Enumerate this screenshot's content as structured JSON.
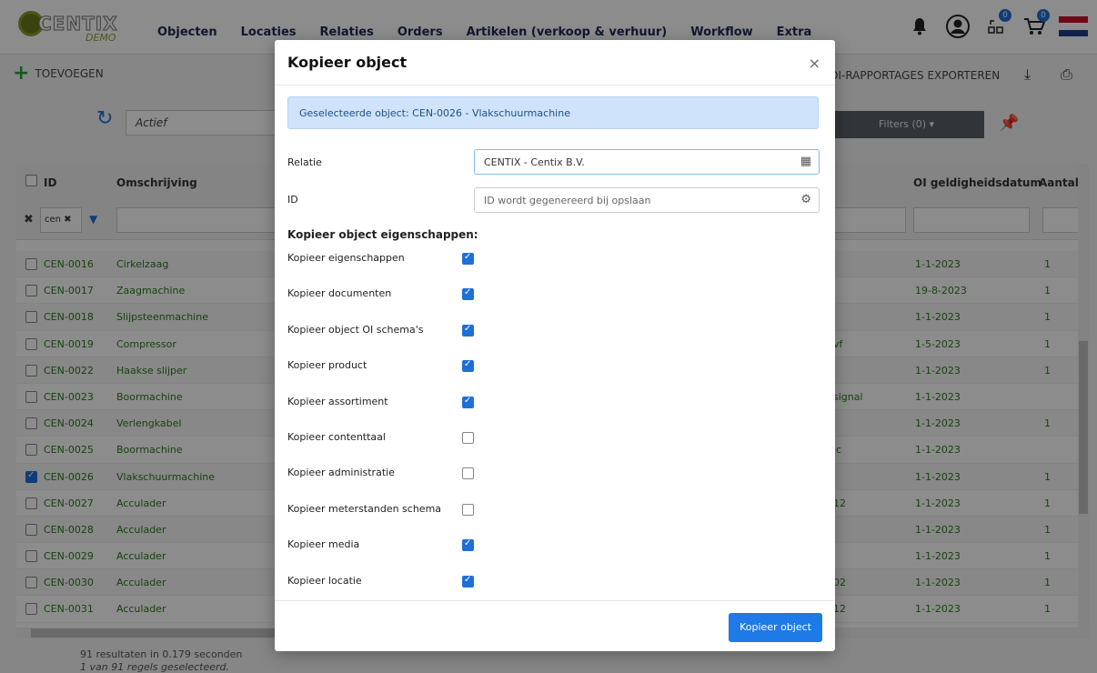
{
  "brand": {
    "name": "CENTIX",
    "tag": "DEMO"
  },
  "nav": {
    "items": [
      "Objecten",
      "Locaties",
      "Relaties",
      "Orders",
      "Artikelen (verkoop & verhuur)",
      "Workflow",
      "Extra"
    ],
    "badges": [
      "0",
      "0"
    ]
  },
  "toolbar": {
    "add_label": "TOEVOEGEN",
    "export_label": "OI-RAPPORTAGES EXPORTEREN"
  },
  "filters": {
    "status_value": "Actief",
    "filters_label": "Filters (0) ▾",
    "id_filter_value": "cen"
  },
  "table": {
    "headers": {
      "id": "ID",
      "description": "Omschrijving",
      "valid_date": "OI geldigheidsdatum",
      "count": "Aantal"
    },
    "rows": [
      {
        "id": "CEN-0016",
        "desc": "Cirkelzaag",
        "extra": "",
        "date": "1-1-2023",
        "count": "1",
        "checked": false
      },
      {
        "id": "CEN-0017",
        "desc": "Zaagmachine",
        "extra": "",
        "date": "19-8-2023",
        "count": "1",
        "checked": false
      },
      {
        "id": "CEN-0018",
        "desc": "Slijpsteenmachine",
        "extra": "",
        "date": "1-1-2023",
        "count": "1",
        "checked": false
      },
      {
        "id": "CEN-0019",
        "desc": "Compressor",
        "extra": "vf",
        "date": "1-5-2023",
        "count": "1",
        "checked": false
      },
      {
        "id": "CEN-0022",
        "desc": "Haakse slijper",
        "extra": "",
        "date": "1-1-2023",
        "count": "1",
        "checked": false
      },
      {
        "id": "CEN-0023",
        "desc": "Boormachine",
        "extra": "signal",
        "date": "1-1-2023",
        "count": "",
        "checked": false
      },
      {
        "id": "CEN-0024",
        "desc": "Verlengkabel",
        "extra": "",
        "date": "1-1-2023",
        "count": "1",
        "checked": false
      },
      {
        "id": "CEN-0025",
        "desc": "Boormachine",
        "extra": "ic",
        "date": "1-1-2023",
        "count": "",
        "checked": false
      },
      {
        "id": "CEN-0026",
        "desc": "Vlakschuurmachine",
        "extra": "",
        "date": "1-1-2023",
        "count": "1",
        "checked": true
      },
      {
        "id": "CEN-0027",
        "desc": "Acculader",
        "extra": "12",
        "date": "1-1-2023",
        "count": "1",
        "checked": false
      },
      {
        "id": "CEN-0028",
        "desc": "Acculader",
        "extra": "",
        "date": "1-1-2023",
        "count": "1",
        "checked": false
      },
      {
        "id": "CEN-0029",
        "desc": "Acculader",
        "extra": "",
        "date": "1-1-2023",
        "count": "1",
        "checked": false
      },
      {
        "id": "CEN-0030",
        "desc": "Acculader",
        "extra": "02",
        "date": "1-1-2023",
        "count": "1",
        "checked": false
      },
      {
        "id": "CEN-0031",
        "desc": "Acculader",
        "extra": "12",
        "date": "1-1-2023",
        "count": "1",
        "checked": false
      }
    ],
    "footer_results": "91 resultaten in 0.179 seconden",
    "footer_selected": "1 van 91 regels geselecteerd."
  },
  "modal": {
    "title": "Kopieer object",
    "info": "Geselecteerde object: CEN-0026 - Vlakschuurmachine",
    "relatie_label": "Relatie",
    "relatie_value": "CENTIX - Centix B.V.",
    "id_label": "ID",
    "id_placeholder": "ID wordt gegenereerd bij opslaan",
    "section_title": "Kopieer object eigenschappen:",
    "options": [
      {
        "label": "Kopieer eigenschappen",
        "checked": true
      },
      {
        "label": "Kopieer documenten",
        "checked": true
      },
      {
        "label": "Kopieer object OI schema's",
        "checked": true
      },
      {
        "label": "Kopieer product",
        "checked": true
      },
      {
        "label": "Kopieer assortiment",
        "checked": true
      },
      {
        "label": "Kopieer contenttaal",
        "checked": false
      },
      {
        "label": "Kopieer administratie",
        "checked": false
      },
      {
        "label": "Kopieer meterstanden schema",
        "checked": false
      },
      {
        "label": "Kopieer media",
        "checked": true
      },
      {
        "label": "Kopieer locatie",
        "checked": true
      }
    ],
    "submit_label": "Kopieer object",
    "close_symbol": "×"
  },
  "colors": {
    "accent": "#1e7ae6",
    "link_green": "#2a7a1d",
    "nav_text": "#1e2a52"
  }
}
